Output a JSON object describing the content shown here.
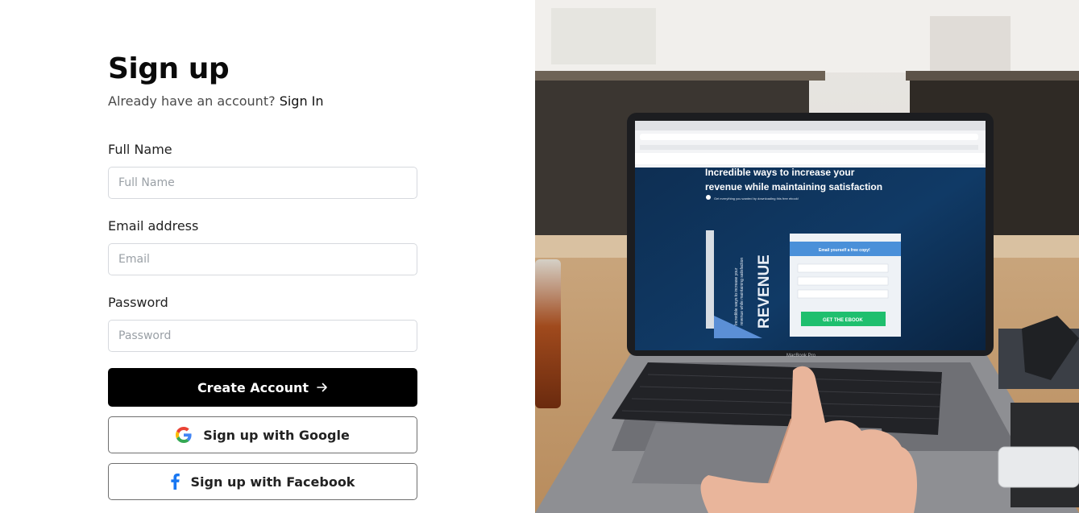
{
  "signup": {
    "title": "Sign up",
    "subtitle_text": "Already have an account?",
    "signin_link": "Sign In",
    "fields": {
      "full_name": {
        "label": "Full Name",
        "placeholder": "Full Name"
      },
      "email": {
        "label": "Email address",
        "placeholder": "Email"
      },
      "password": {
        "label": "Password",
        "placeholder": "Password"
      }
    },
    "create_account_label": "Create Account",
    "google_label": "Sign up with Google",
    "facebook_label": "Sign up with Facebook"
  },
  "icons": {
    "arrow": "arrow-right-icon",
    "google": "google-icon",
    "facebook": "facebook-icon"
  },
  "colors": {
    "primary_button": "#000000",
    "facebook_blue": "#1877f2",
    "google_blue": "#4285f4",
    "google_red": "#ea4335",
    "google_yellow": "#fbbc05",
    "google_green": "#34a853"
  },
  "hero_image": {
    "screen_headline_1": "Incredible ways to increase your",
    "screen_headline_2": "revenue while maintaining satisfaction",
    "screen_subline": "Get everything you wanted by downloading this free ebook!",
    "book_title": "REVENUE",
    "book_subtitle": "Incredible ways to increase your revenue while maintaining satisfaction",
    "form_card_title": "Email yourself a free copy!",
    "form_card_button": "GET THE EBOOK",
    "laptop_brand": "MacBook Pro"
  }
}
